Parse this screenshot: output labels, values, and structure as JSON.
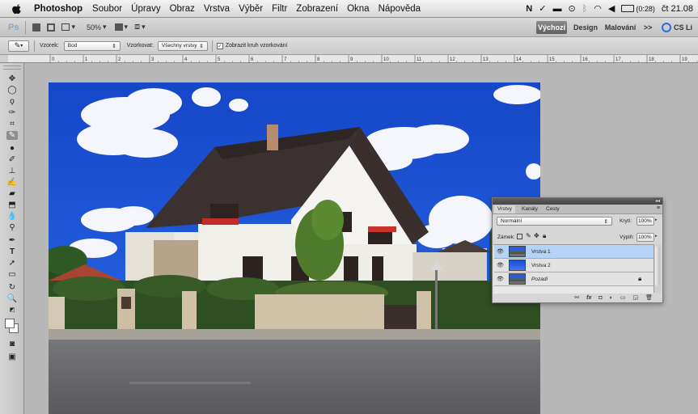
{
  "menubar": {
    "app_name": "Photoshop",
    "menus": [
      "Soubor",
      "Úpravy",
      "Obraz",
      "Vrstva",
      "Výběr",
      "Filtr",
      "Zobrazení",
      "Okna",
      "Nápověda"
    ],
    "battery": "(0:28)",
    "clock": "čt 21.08"
  },
  "appbar": {
    "ps_logo": "Ps",
    "zoom": "50%",
    "workspaces": {
      "active": "Výchozí",
      "design": "Design",
      "painting": "Malování",
      "more": ">>",
      "cs_live": "CS Li"
    }
  },
  "options": {
    "sample_size_label": "Vzorek:",
    "sample_size_value": "Bod",
    "sample_label": "Vzorkovat:",
    "sample_value": "Všechny vrstvy",
    "show_ring_label": "Zobrazit kruh vzorkování",
    "show_ring_checked": true
  },
  "ruler": {
    "ticks": [
      "0",
      "1",
      "2",
      "3",
      "4",
      "5",
      "6",
      "7",
      "8",
      "9",
      "10",
      "11",
      "12",
      "13",
      "14",
      "15",
      "16",
      "17",
      "18",
      "19"
    ]
  },
  "layers_panel": {
    "tabs": [
      "Vrstvy",
      "Kanály",
      "Cesty"
    ],
    "blend_mode": "Normální",
    "opacity_label": "Krytí:",
    "opacity_value": "100%",
    "lock_label": "Zámek:",
    "fill_label": "Výplň:",
    "fill_value": "100%",
    "layers": [
      {
        "name": "Vrstva 1",
        "selected": true,
        "thumb": "photo"
      },
      {
        "name": "Vrstva 2",
        "selected": false,
        "thumb": "blue"
      },
      {
        "name": "Pozadí",
        "selected": false,
        "thumb": "photo",
        "locked": true
      }
    ]
  },
  "colors": {
    "sky": "#1c55d8",
    "selected_layer": "#b4d3f5",
    "accent_blue": "#2e6fdd"
  }
}
